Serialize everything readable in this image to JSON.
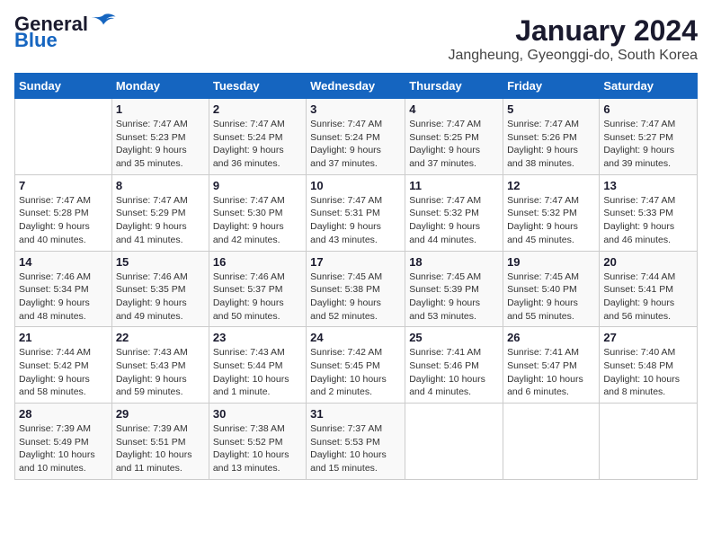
{
  "header": {
    "logo_line1": "General",
    "logo_line2": "Blue",
    "title": "January 2024",
    "subtitle": "Jangheung, Gyeonggi-do, South Korea"
  },
  "columns": [
    "Sunday",
    "Monday",
    "Tuesday",
    "Wednesday",
    "Thursday",
    "Friday",
    "Saturday"
  ],
  "weeks": [
    [
      {
        "num": "",
        "info": ""
      },
      {
        "num": "1",
        "info": "Sunrise: 7:47 AM\nSunset: 5:23 PM\nDaylight: 9 hours\nand 35 minutes."
      },
      {
        "num": "2",
        "info": "Sunrise: 7:47 AM\nSunset: 5:24 PM\nDaylight: 9 hours\nand 36 minutes."
      },
      {
        "num": "3",
        "info": "Sunrise: 7:47 AM\nSunset: 5:24 PM\nDaylight: 9 hours\nand 37 minutes."
      },
      {
        "num": "4",
        "info": "Sunrise: 7:47 AM\nSunset: 5:25 PM\nDaylight: 9 hours\nand 37 minutes."
      },
      {
        "num": "5",
        "info": "Sunrise: 7:47 AM\nSunset: 5:26 PM\nDaylight: 9 hours\nand 38 minutes."
      },
      {
        "num": "6",
        "info": "Sunrise: 7:47 AM\nSunset: 5:27 PM\nDaylight: 9 hours\nand 39 minutes."
      }
    ],
    [
      {
        "num": "7",
        "info": "Sunrise: 7:47 AM\nSunset: 5:28 PM\nDaylight: 9 hours\nand 40 minutes."
      },
      {
        "num": "8",
        "info": "Sunrise: 7:47 AM\nSunset: 5:29 PM\nDaylight: 9 hours\nand 41 minutes."
      },
      {
        "num": "9",
        "info": "Sunrise: 7:47 AM\nSunset: 5:30 PM\nDaylight: 9 hours\nand 42 minutes."
      },
      {
        "num": "10",
        "info": "Sunrise: 7:47 AM\nSunset: 5:31 PM\nDaylight: 9 hours\nand 43 minutes."
      },
      {
        "num": "11",
        "info": "Sunrise: 7:47 AM\nSunset: 5:32 PM\nDaylight: 9 hours\nand 44 minutes."
      },
      {
        "num": "12",
        "info": "Sunrise: 7:47 AM\nSunset: 5:32 PM\nDaylight: 9 hours\nand 45 minutes."
      },
      {
        "num": "13",
        "info": "Sunrise: 7:47 AM\nSunset: 5:33 PM\nDaylight: 9 hours\nand 46 minutes."
      }
    ],
    [
      {
        "num": "14",
        "info": "Sunrise: 7:46 AM\nSunset: 5:34 PM\nDaylight: 9 hours\nand 48 minutes."
      },
      {
        "num": "15",
        "info": "Sunrise: 7:46 AM\nSunset: 5:35 PM\nDaylight: 9 hours\nand 49 minutes."
      },
      {
        "num": "16",
        "info": "Sunrise: 7:46 AM\nSunset: 5:37 PM\nDaylight: 9 hours\nand 50 minutes."
      },
      {
        "num": "17",
        "info": "Sunrise: 7:45 AM\nSunset: 5:38 PM\nDaylight: 9 hours\nand 52 minutes."
      },
      {
        "num": "18",
        "info": "Sunrise: 7:45 AM\nSunset: 5:39 PM\nDaylight: 9 hours\nand 53 minutes."
      },
      {
        "num": "19",
        "info": "Sunrise: 7:45 AM\nSunset: 5:40 PM\nDaylight: 9 hours\nand 55 minutes."
      },
      {
        "num": "20",
        "info": "Sunrise: 7:44 AM\nSunset: 5:41 PM\nDaylight: 9 hours\nand 56 minutes."
      }
    ],
    [
      {
        "num": "21",
        "info": "Sunrise: 7:44 AM\nSunset: 5:42 PM\nDaylight: 9 hours\nand 58 minutes."
      },
      {
        "num": "22",
        "info": "Sunrise: 7:43 AM\nSunset: 5:43 PM\nDaylight: 9 hours\nand 59 minutes."
      },
      {
        "num": "23",
        "info": "Sunrise: 7:43 AM\nSunset: 5:44 PM\nDaylight: 10 hours\nand 1 minute."
      },
      {
        "num": "24",
        "info": "Sunrise: 7:42 AM\nSunset: 5:45 PM\nDaylight: 10 hours\nand 2 minutes."
      },
      {
        "num": "25",
        "info": "Sunrise: 7:41 AM\nSunset: 5:46 PM\nDaylight: 10 hours\nand 4 minutes."
      },
      {
        "num": "26",
        "info": "Sunrise: 7:41 AM\nSunset: 5:47 PM\nDaylight: 10 hours\nand 6 minutes."
      },
      {
        "num": "27",
        "info": "Sunrise: 7:40 AM\nSunset: 5:48 PM\nDaylight: 10 hours\nand 8 minutes."
      }
    ],
    [
      {
        "num": "28",
        "info": "Sunrise: 7:39 AM\nSunset: 5:49 PM\nDaylight: 10 hours\nand 10 minutes."
      },
      {
        "num": "29",
        "info": "Sunrise: 7:39 AM\nSunset: 5:51 PM\nDaylight: 10 hours\nand 11 minutes."
      },
      {
        "num": "30",
        "info": "Sunrise: 7:38 AM\nSunset: 5:52 PM\nDaylight: 10 hours\nand 13 minutes."
      },
      {
        "num": "31",
        "info": "Sunrise: 7:37 AM\nSunset: 5:53 PM\nDaylight: 10 hours\nand 15 minutes."
      },
      {
        "num": "",
        "info": ""
      },
      {
        "num": "",
        "info": ""
      },
      {
        "num": "",
        "info": ""
      }
    ]
  ]
}
